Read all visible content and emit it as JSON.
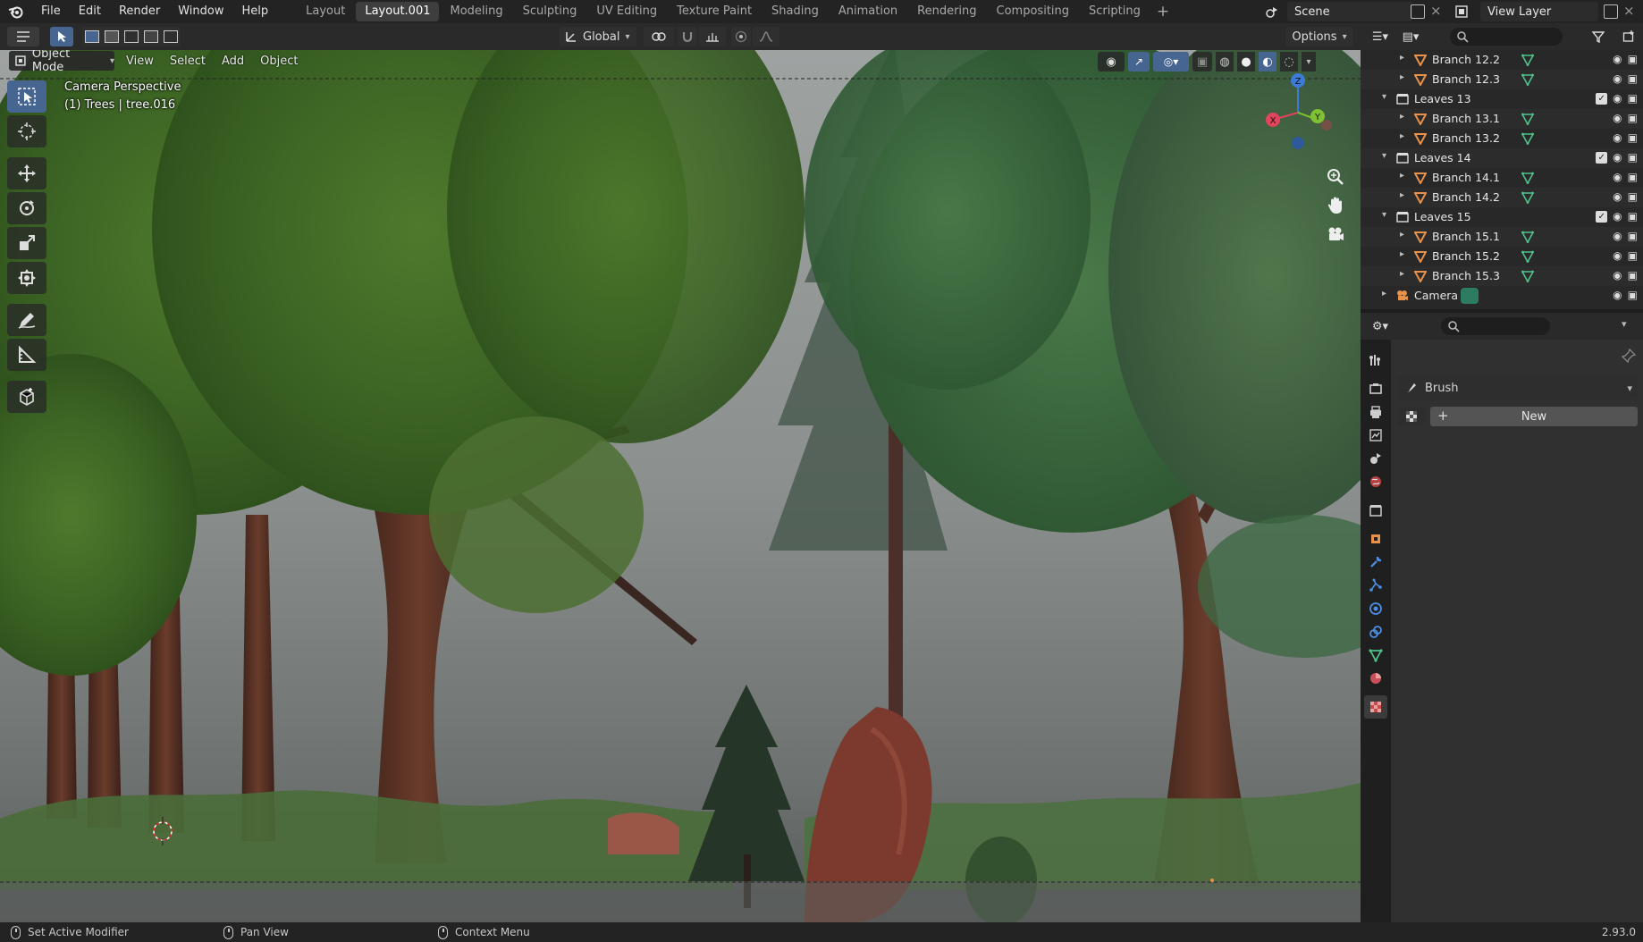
{
  "topbar": {
    "menus": [
      "File",
      "Edit",
      "Render",
      "Window",
      "Help"
    ],
    "workspaces": [
      "Layout",
      "Layout.001",
      "Modeling",
      "Sculpting",
      "UV Editing",
      "Texture Paint",
      "Shading",
      "Animation",
      "Rendering",
      "Compositing",
      "Scripting"
    ],
    "active_workspace": "Layout.001",
    "scene": "Scene",
    "view_layer": "View Layer"
  },
  "header": {
    "orientation": "Global",
    "options": "Options"
  },
  "viewport": {
    "mode": "Object Mode",
    "menus": [
      "View",
      "Select",
      "Add",
      "Object"
    ],
    "camera_label": "Camera Perspective",
    "object_label": "(1) Trees | tree.016",
    "gizmo_axes": {
      "x": "X",
      "y": "Y",
      "z": "Z"
    }
  },
  "outliner": {
    "rows": [
      {
        "indent": 2,
        "label": "Branch 12.2",
        "type": "mesh"
      },
      {
        "indent": 2,
        "label": "Branch 12.3",
        "type": "mesh"
      },
      {
        "indent": 1,
        "label": "Leaves 13",
        "type": "collection"
      },
      {
        "indent": 2,
        "label": "Branch 13.1",
        "type": "mesh"
      },
      {
        "indent": 2,
        "label": "Branch 13.2",
        "type": "mesh"
      },
      {
        "indent": 1,
        "label": "Leaves 14",
        "type": "collection"
      },
      {
        "indent": 2,
        "label": "Branch 14.1",
        "type": "mesh"
      },
      {
        "indent": 2,
        "label": "Branch 14.2",
        "type": "mesh"
      },
      {
        "indent": 1,
        "label": "Leaves 15",
        "type": "collection"
      },
      {
        "indent": 2,
        "label": "Branch 15.1",
        "type": "mesh"
      },
      {
        "indent": 2,
        "label": "Branch 15.2",
        "type": "mesh"
      },
      {
        "indent": 2,
        "label": "Branch 15.3",
        "type": "mesh"
      },
      {
        "indent": 1,
        "label": "Camera",
        "type": "camera"
      }
    ]
  },
  "properties": {
    "brush_label": "Brush",
    "new_button": "New"
  },
  "statusbar": {
    "left_action": "Set Active Modifier",
    "middle_action": "Pan View",
    "right_action": "Context Menu",
    "version": "2.93.0"
  },
  "colors": {
    "accent": "#476591",
    "mesh_orange": "#e8914a",
    "data_green": "#4fc18b",
    "axis_x": "#e2445c",
    "axis_y": "#7ec132",
    "axis_z": "#3d7bd6"
  }
}
